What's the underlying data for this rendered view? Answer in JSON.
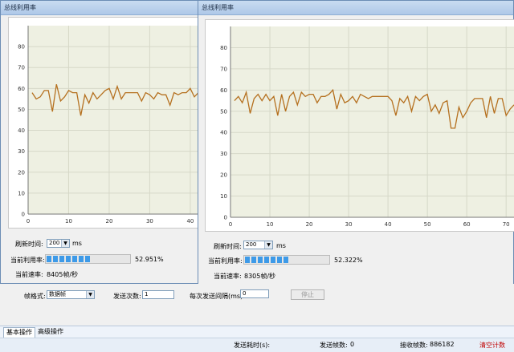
{
  "windows": [
    {
      "title": "总线利用率",
      "refresh_label": "刷新时间:",
      "refresh_value": "200",
      "refresh_unit": "ms",
      "util_label": "当前利用率:",
      "util_value": "52.951%",
      "util_fraction": 0.52951,
      "speed_label": "当前速率:",
      "speed_value": "8405帧/秒"
    },
    {
      "title": "总线利用率",
      "refresh_label": "刷新时间:",
      "refresh_value": "200",
      "refresh_unit": "ms",
      "util_label": "当前利用率:",
      "util_value": "52.322%",
      "util_fraction": 0.52322,
      "speed_label": "当前速率:",
      "speed_value": "8305帧/秒"
    }
  ],
  "form": {
    "frame_format_label": "帧格式:",
    "frame_format_value": "数据帧",
    "send_count_label": "发送次数:",
    "send_count_value": "1",
    "interval_label": "每次发送间隔(ms):",
    "interval_value": "0",
    "stop_button": "停止"
  },
  "tabs": [
    "基本操作",
    "高级操作"
  ],
  "status": {
    "elapsed_label": "发送耗时(s):",
    "sent_label": "发送帧数:",
    "sent_value": "0",
    "recv_label": "接收帧数:",
    "recv_value": "886182",
    "clear_button": "清空计数"
  },
  "colors": {
    "line": "#b5701f",
    "plot_bg": "#eef0e2",
    "grid": "#d6d8c8",
    "accent": "#3d9ae8",
    "clear": "#c00000"
  },
  "chart_data": [
    {
      "type": "line",
      "ylim": [
        0,
        90
      ],
      "xlim": [
        0,
        42
      ],
      "y_ticks": [
        0,
        10,
        20,
        30,
        40,
        50,
        60,
        70,
        80
      ],
      "x_ticks": [
        0,
        10,
        20,
        30,
        40
      ],
      "x": [
        1,
        2,
        3,
        4,
        5,
        6,
        7,
        8,
        9,
        10,
        11,
        12,
        13,
        14,
        15,
        16,
        17,
        18,
        19,
        20,
        21,
        22,
        23,
        24,
        25,
        26,
        27,
        28,
        29,
        30,
        31,
        32,
        33,
        34,
        35,
        36,
        37,
        38,
        39,
        40,
        41,
        42
      ],
      "values": [
        58,
        55,
        56,
        59,
        59,
        49,
        62,
        54,
        56,
        59,
        58,
        58,
        47,
        57,
        53,
        58,
        55,
        57,
        59,
        60,
        55,
        61,
        55,
        58,
        58,
        58,
        58,
        54,
        58,
        57,
        55,
        58,
        57,
        57,
        52,
        58,
        57,
        58,
        58,
        60,
        56,
        58
      ]
    },
    {
      "type": "line",
      "ylim": [
        0,
        90
      ],
      "xlim": [
        0,
        72
      ],
      "y_ticks": [
        0,
        10,
        20,
        30,
        40,
        50,
        60,
        70,
        80
      ],
      "x_ticks": [
        0,
        10,
        20,
        30,
        40,
        50,
        60,
        70
      ],
      "x": [
        1,
        2,
        3,
        4,
        5,
        6,
        7,
        8,
        9,
        10,
        11,
        12,
        13,
        14,
        15,
        16,
        17,
        18,
        19,
        20,
        21,
        22,
        23,
        24,
        25,
        26,
        27,
        28,
        29,
        30,
        31,
        32,
        33,
        34,
        35,
        36,
        37,
        38,
        39,
        40,
        41,
        42,
        43,
        44,
        45,
        46,
        47,
        48,
        49,
        50,
        51,
        52,
        53,
        54,
        55,
        56,
        57,
        58,
        59,
        60,
        61,
        62,
        63,
        64,
        65,
        66,
        67,
        68,
        69,
        70,
        71,
        72
      ],
      "values": [
        55,
        57,
        54,
        59,
        49,
        56,
        58,
        55,
        58,
        55,
        57,
        48,
        58,
        50,
        57,
        59,
        53,
        59,
        57,
        58,
        58,
        54,
        57,
        57,
        58,
        60,
        51,
        58,
        54,
        55,
        57,
        54,
        58,
        57,
        56,
        57,
        57,
        57,
        57,
        57,
        55,
        48,
        56,
        54,
        57,
        50,
        57,
        55,
        57,
        58,
        50,
        53,
        49,
        54,
        55,
        42,
        42,
        52,
        47,
        50,
        54,
        56,
        56,
        56,
        47,
        57,
        49,
        56,
        56,
        48,
        51,
        53
      ]
    }
  ]
}
